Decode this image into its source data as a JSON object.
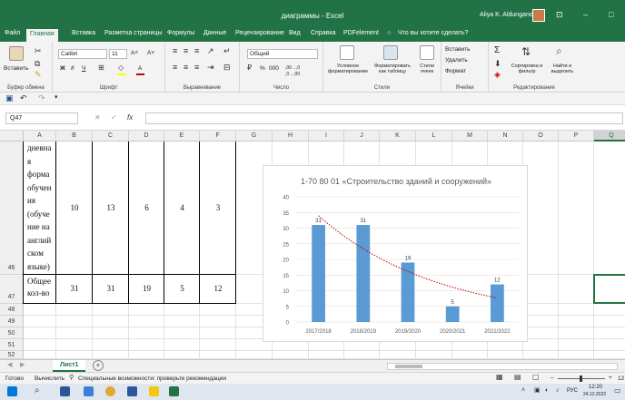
{
  "window": {
    "title": "диаграммы  -  Excel",
    "user": "Aliya K. Aldunganova",
    "controls": [
      "⊡",
      "–",
      "□"
    ]
  },
  "menu": {
    "tabs": [
      "Файл",
      "Главная",
      "Вставка",
      "Разметка страницы",
      "Формулы",
      "Данные",
      "Рецензирование",
      "Вид",
      "Справка",
      "PDFelement"
    ],
    "search": "Что вы хотите сделать?",
    "active": "Главная"
  },
  "ribbon": {
    "clipboard": {
      "paste": "Вставить",
      "label": "Буфер обмена"
    },
    "font": {
      "name": "Calibri",
      "size": "11",
      "bold": "Ж",
      "italic": "К",
      "underline": "Ч",
      "grow": "A˄",
      "shrink": "A˅",
      "color_letter": "A",
      "label": "Шрифт",
      "accent": "#ffff00",
      "font_color": "#c00000"
    },
    "alignment": {
      "label": "Выравнивание"
    },
    "number": {
      "format": "Общий",
      "percent": "%",
      "thousands": "000",
      "dec_inc": ",00→,0",
      "dec_dec": ",0→,00",
      "label": "Число"
    },
    "styles": {
      "conditional": "Условное форматирование",
      "format_table": "Форматировать как таблицу",
      "cell_styles": "Стили ячеек",
      "label": "Стили"
    },
    "cells": {
      "insert": "Вставить",
      "delete": "Удалить",
      "format": "Формат",
      "label": "Ячейки"
    },
    "editing": {
      "sum": "Σ",
      "sort": "Сортировка и фильтр",
      "find": "Найти и выделить",
      "label": "Редактирование"
    }
  },
  "formula_bar": {
    "name_box": "Q47",
    "fx": "fx",
    "cancel": "✕",
    "enter": "✓",
    "content": ""
  },
  "columns": [
    {
      "name": "A",
      "w": 36
    },
    {
      "name": "B",
      "w": 40
    },
    {
      "name": "C",
      "w": 40
    },
    {
      "name": "D",
      "w": 39
    },
    {
      "name": "E",
      "w": 39
    },
    {
      "name": "F",
      "w": 40
    },
    {
      "name": "G",
      "w": 40
    },
    {
      "name": "H",
      "w": 40
    },
    {
      "name": "I",
      "w": 39
    },
    {
      "name": "J",
      "w": 39
    },
    {
      "name": "K",
      "w": 40
    },
    {
      "name": "L",
      "w": 40
    },
    {
      "name": "M",
      "w": 39
    },
    {
      "name": "N",
      "w": 39
    },
    {
      "name": "O",
      "w": 39
    },
    {
      "name": "P",
      "w": 39
    },
    {
      "name": "Q",
      "w": 39
    }
  ],
  "selected_column": "Q",
  "rows": [
    {
      "num": "46",
      "h": 147
    },
    {
      "num": "47",
      "h": 32
    },
    {
      "num": "48",
      "h": 13
    },
    {
      "num": "49",
      "h": 13
    },
    {
      "num": "50",
      "h": 13
    },
    {
      "num": "51",
      "h": 13
    },
    {
      "num": "52",
      "h": 9
    }
  ],
  "table": {
    "r46": {
      "label": [
        "дневна",
        "я",
        "форма",
        "обучен",
        "ия",
        "(обуче",
        "ние на",
        "англий",
        "ском",
        "языке)"
      ],
      "values": [
        "10",
        "13",
        "6",
        "4",
        "3"
      ]
    },
    "r47": {
      "label": [
        "Общее",
        "кол-во"
      ],
      "values": [
        "31",
        "31",
        "19",
        "5",
        "12"
      ]
    }
  },
  "chart_data": {
    "type": "bar",
    "title": "1-70 80  01 «Строительство зданий и сооружений»",
    "categories": [
      "2017/2018",
      "2018/2019",
      "2019/2020",
      "2020/2021",
      "2021/2022"
    ],
    "values": [
      31,
      31,
      19,
      5,
      12
    ],
    "data_labels": [
      "31",
      "31",
      "19",
      "5",
      "12"
    ],
    "yticks": [
      "0",
      "5",
      "10",
      "15",
      "20",
      "25",
      "30",
      "35",
      "40"
    ],
    "ylim": [
      0,
      40
    ],
    "trendline": {
      "kind": "exponential",
      "color": "#c00000"
    },
    "bar_color": "#5b9bd5",
    "grid": true,
    "legend": "none"
  },
  "sheets": {
    "active": "Лист1",
    "add": "+"
  },
  "status": {
    "ready": "Готово",
    "calc": "Вычислить",
    "accessibility": "Специальные возможности: проверьте рекомендации",
    "zoom": "12"
  },
  "taskbar": {
    "time": "12:20",
    "date": "24.12.2022",
    "lang": "РУС"
  }
}
